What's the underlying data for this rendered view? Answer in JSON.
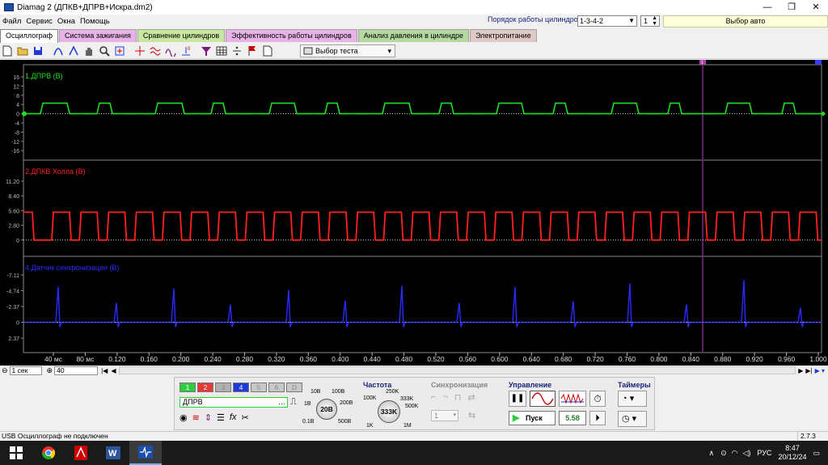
{
  "window": {
    "title": "Diamag 2 (ДПКВ+ДПРВ+Искра.dm2)"
  },
  "menu": [
    "Файл",
    "Сервис",
    "Окна",
    "Помощь"
  ],
  "header_right": {
    "cyl_order_label": "Порядок работы цилиндров",
    "cyl_order_value": "1-3-4-2",
    "cyl_number": "1",
    "auto_select": "Выбор авто"
  },
  "tabs": [
    {
      "label": "Осциллограф",
      "active": true,
      "color": "#ffffff"
    },
    {
      "label": "Система зажигания",
      "color": "#e8b4e8"
    },
    {
      "label": "Сравнение цилиндров",
      "color": "#c8e6a0"
    },
    {
      "label": "Эффективность работы цилиндров",
      "color": "#e8b4e8"
    },
    {
      "label": "Анализ давления в цилиндре",
      "color": "#b4d8a0"
    },
    {
      "label": "Электропитание",
      "color": "#e0c8c8"
    }
  ],
  "toolbar": {
    "test_select": "Выбор теста"
  },
  "channels": [
    {
      "name": "1.ДПРВ (В)",
      "color": "#22dd22",
      "ticks": [
        "16",
        "12",
        "8",
        "4",
        "0",
        "-4",
        "-8",
        "-12",
        "-16"
      ]
    },
    {
      "name": "2.ДПКВ Холла (В)",
      "color": "#ff2020",
      "ticks": [
        "11.20",
        "8.40",
        "5.60",
        "2.80",
        "0"
      ]
    },
    {
      "name": "4.Датчик синхронизации (В)",
      "color": "#2a2aff",
      "ticks": [
        "-7.11",
        "-4.74",
        "-2.37",
        "0",
        "2.37"
      ]
    }
  ],
  "time_axis": [
    "40 мс",
    "80 мс",
    "0.120",
    "0.160",
    "0.200",
    "0.240",
    "0.280",
    "0.320",
    "0.360",
    "0.400",
    "0.440",
    "0.480",
    "0.520",
    "0.560",
    "0.600",
    "0.640",
    "0.680",
    "0.720",
    "0.760",
    "0.800",
    "0.840",
    "0.880",
    "0.920",
    "0.960",
    "1.000"
  ],
  "cursor_marker": "1",
  "scroll": {
    "timebase": "1 сек",
    "zoom": "40"
  },
  "controls": {
    "channel_buttons": [
      {
        "label": "1",
        "color": "#2ecc40"
      },
      {
        "label": "2",
        "color": "#e53935"
      },
      {
        "label": "3",
        "color": "#b0b0b0"
      },
      {
        "label": "4",
        "color": "#1e3ad8"
      },
      {
        "label": "5",
        "color": "#c8c8c8"
      },
      {
        "label": "6",
        "color": "#c8c8c8"
      },
      {
        "label": "D",
        "color": "#c8c8c8"
      }
    ],
    "channel_name": "ДПРВ",
    "volt_knob": {
      "value": "20В",
      "labels": [
        "10В",
        "100В",
        "1В",
        "200В",
        "0.1В",
        "500В"
      ]
    },
    "freq": {
      "title": "Частота",
      "value": "333K",
      "labels": [
        "250K",
        "100K",
        "333K",
        "500K",
        "1K",
        "1M"
      ]
    },
    "sync": {
      "title": "Синхронизация",
      "value": "1"
    },
    "control": {
      "title": "Управление",
      "start": "Пуск",
      "value": "5.58"
    },
    "timers": {
      "title": "Таймеры"
    }
  },
  "status": {
    "text": "USB Осциллограф не подключен",
    "version": "2.7.3"
  },
  "taskbar": {
    "lang": "РУС",
    "time": "8:47",
    "date": "20/12/24"
  }
}
